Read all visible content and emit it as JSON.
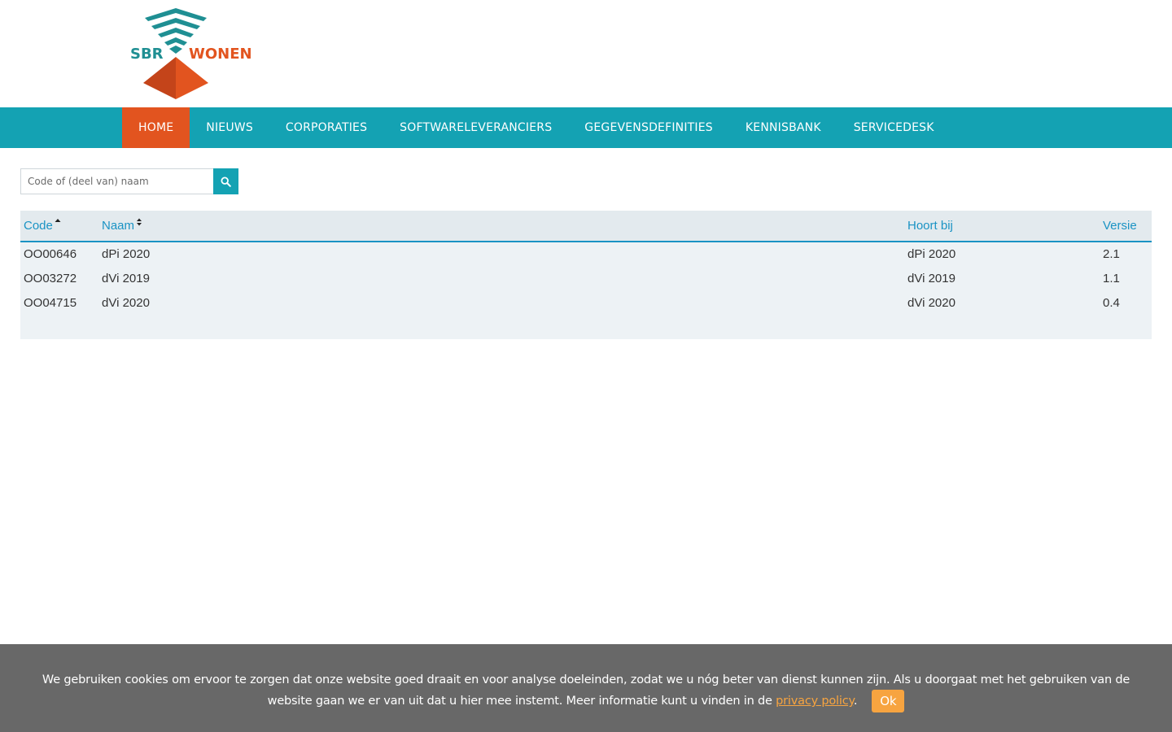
{
  "logo": {
    "left_text": "SBR",
    "right_text": "WONEN"
  },
  "colors": {
    "nav_bg": "#14a2b3",
    "nav_active": "#e2541f",
    "link": "#1a93c4",
    "cookie_bg": "#686868",
    "accent_orange": "#f7a440"
  },
  "nav": {
    "items": [
      {
        "label": "HOME",
        "active": true
      },
      {
        "label": "NIEUWS"
      },
      {
        "label": "CORPORATIES"
      },
      {
        "label": "SOFTWARELEVERANCIERS"
      },
      {
        "label": "GEGEVENSDEFINITIES"
      },
      {
        "label": "KENNISBANK"
      },
      {
        "label": "SERVICEDESK"
      }
    ]
  },
  "search": {
    "placeholder": "Code of (deel van) naam",
    "icon": "search-icon"
  },
  "table": {
    "headers": {
      "code": "Code",
      "naam": "Naam",
      "hoort_bij": "Hoort bij",
      "versie": "Versie"
    },
    "rows": [
      {
        "code": "OO00646",
        "naam": "dPi 2020",
        "hoort_bij": "dPi 2020",
        "versie": "2.1"
      },
      {
        "code": "OO03272",
        "naam": "dVi 2019",
        "hoort_bij": "dVi 2019",
        "versie": "1.1"
      },
      {
        "code": "OO04715",
        "naam": "dVi 2020",
        "hoort_bij": "dVi 2020",
        "versie": "0.4"
      }
    ]
  },
  "cookie": {
    "text": "We gebruiken cookies om ervoor te zorgen dat onze website goed draait en voor analyse doeleinden, zodat we u nóg beter van dienst kunnen zijn. Als u doorgaat met het gebruiken van de website gaan we er van uit dat u hier mee instemt. Meer informatie kunt u vinden in de",
    "link": "privacy policy",
    "after_link": ".",
    "ok_label": "Ok"
  }
}
